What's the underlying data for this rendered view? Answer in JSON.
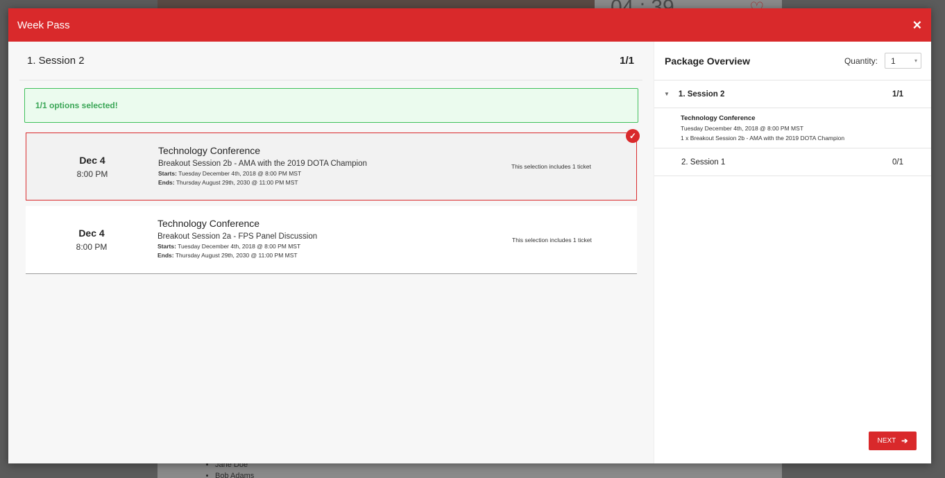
{
  "background": {
    "countdown_text": "04 : 39",
    "list_items": [
      "Jane Doe",
      "Bob Adams"
    ]
  },
  "modal": {
    "title": "Week Pass",
    "close_icon": "close-icon"
  },
  "left": {
    "session_title": "1. Session 2",
    "session_count": "1/1",
    "alert_text": "1/1 options selected!",
    "options": [
      {
        "day": "Dec 4",
        "time": "8:00 PM",
        "event": "Technology Conference",
        "description": "Breakout Session 2b - AMA with the 2019 DOTA Champion",
        "starts_label": "Starts:",
        "starts": "Tuesday December 4th, 2018 @ 8:00 PM MST",
        "ends_label": "Ends:",
        "ends": "Thursday August 29th, 2030 @ 11:00 PM MST",
        "note": "This selection includes 1 ticket",
        "selected": true
      },
      {
        "day": "Dec 4",
        "time": "8:00 PM",
        "event": "Technology Conference",
        "description": "Breakout Session 2a - FPS Panel Discussion",
        "starts_label": "Starts:",
        "starts": "Tuesday December 4th, 2018 @ 8:00 PM MST",
        "ends_label": "Ends:",
        "ends": "Thursday August 29th, 2030 @ 11:00 PM MST",
        "note": "This selection includes 1 ticket",
        "selected": false
      }
    ]
  },
  "right": {
    "title": "Package Overview",
    "quantity_label": "Quantity:",
    "quantity_value": "1",
    "sessions": [
      {
        "label": "1. Session 2",
        "count": "1/1",
        "detail_event": "Technology Conference",
        "detail_date": "Tuesday December 4th, 2018 @ 8:00 PM MST",
        "detail_item": "1 x Breakout Session 2b - AMA with the 2019 DOTA Champion"
      },
      {
        "label": "2. Session 1",
        "count": "0/1"
      }
    ],
    "next_label": "NEXT"
  },
  "colors": {
    "accent": "#d9292b",
    "success": "#3aa656"
  }
}
